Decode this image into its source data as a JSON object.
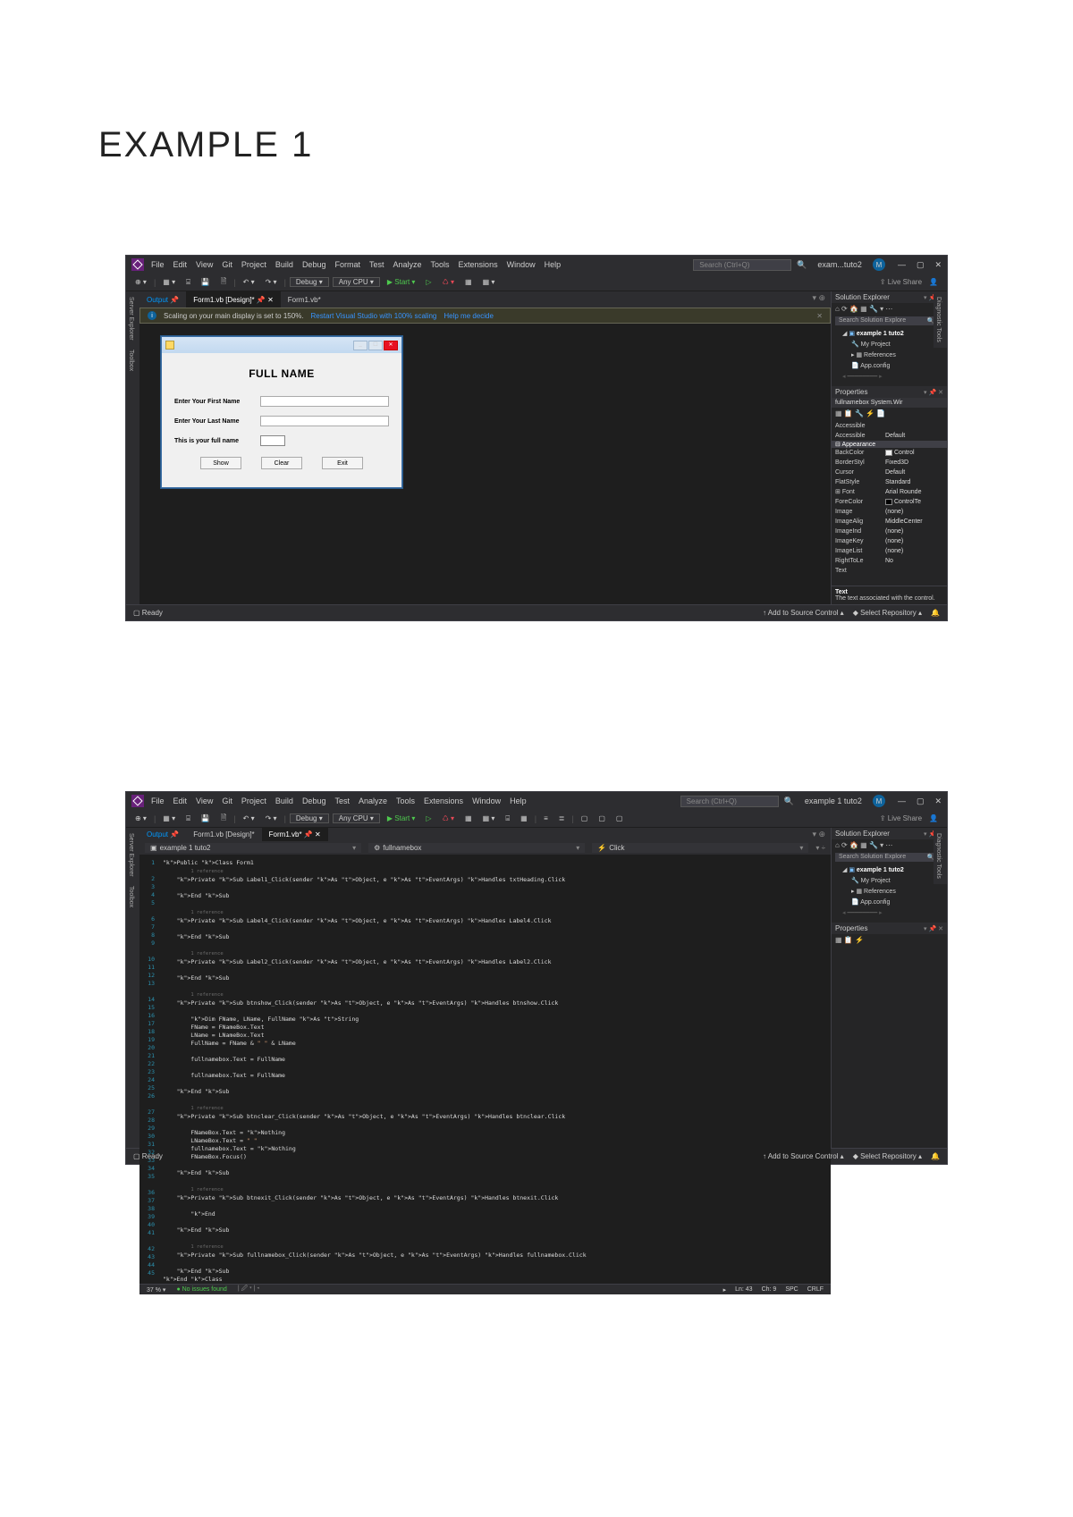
{
  "heading": "EXAMPLE 1",
  "menu": [
    "File",
    "Edit",
    "View",
    "Git",
    "Project",
    "Build",
    "Debug",
    "Format",
    "Test",
    "Analyze",
    "Tools",
    "Extensions",
    "Window",
    "Help"
  ],
  "menu2": [
    "File",
    "Edit",
    "View",
    "Git",
    "Project",
    "Build",
    "Debug",
    "Test",
    "Analyze",
    "Tools",
    "Extensions",
    "Window",
    "Help"
  ],
  "search_placeholder": "Search (Ctrl+Q)",
  "project_title1": "exam...tuto2",
  "project_title2": "example 1 tuto2",
  "liveshare": "Live Share",
  "toolbar": {
    "config": "Debug",
    "platform": "Any CPU",
    "start": "Start"
  },
  "tabs1": {
    "output": "Output",
    "design": "Form1.vb [Design]*",
    "code": "Form1.vb*"
  },
  "tabs2": {
    "output": "Output",
    "design": "Form1.vb [Design]*",
    "code": "Form1.vb*"
  },
  "context": {
    "project": "example 1 tuto2",
    "member": "fullnamebox",
    "event": "Click"
  },
  "notif": {
    "msg": "Scaling on your main display is set to 150%.",
    "link1": "Restart Visual Studio with 100% scaling",
    "link2": "Help me decide"
  },
  "form": {
    "heading": "FULL NAME",
    "row1": "Enter Your First Name",
    "row2": "Enter Your Last Name",
    "row3": "This is your full name",
    "btns": [
      "Show",
      "Clear",
      "Exit"
    ]
  },
  "side_rails": [
    "Server Explorer",
    "Toolbox"
  ],
  "diag_rail": "Diagnostic Tools",
  "solexp": {
    "title": "Solution Explorer",
    "search": "Search Solution Explore",
    "root": "example 1 tuto2",
    "nodes": [
      "My Project",
      "References",
      "App.config"
    ]
  },
  "props": {
    "title": "Properties",
    "object": "fullnamebox System.Wir",
    "rows": [
      {
        "k": "Accessible",
        "v": ""
      },
      {
        "k": "Accessible",
        "v": "Default"
      }
    ],
    "cat": "Appearance",
    "rows2": [
      {
        "k": "BackColor",
        "v": "Control"
      },
      {
        "k": "BorderStyl",
        "v": "Fixed3D"
      },
      {
        "k": "Cursor",
        "v": "Default"
      },
      {
        "k": "FlatStyle",
        "v": "Standard"
      },
      {
        "k": "Font",
        "v": "Arial Rounde"
      },
      {
        "k": "ForeColor",
        "v": "ControlTe"
      },
      {
        "k": "Image",
        "v": "(none)"
      },
      {
        "k": "ImageAlig",
        "v": "MiddleCenter"
      },
      {
        "k": "ImageInd",
        "v": "(none)"
      },
      {
        "k": "ImageKey",
        "v": "(none)"
      },
      {
        "k": "ImageList",
        "v": "(none)"
      },
      {
        "k": "RightToLe",
        "v": "No"
      },
      {
        "k": "Text",
        "v": ""
      }
    ],
    "desc_t": "Text",
    "desc": "The text associated with the control."
  },
  "status": {
    "ready": "Ready",
    "add": "Add to Source Control",
    "repo": "Select Repository"
  },
  "editor_status": {
    "zoom": "37 %",
    "issues": "No issues found",
    "ln": "Ln: 43",
    "ch": "Ch: 9",
    "spc": "SPC",
    "crlf": "CRLF"
  },
  "code_lines": [
    "Public Class Form1",
    "    1 reference",
    "    Private Sub Label1_Click(sender As Object, e As EventArgs) Handles txtHeading.Click",
    "",
    "    End Sub",
    "",
    "    1 reference",
    "    Private Sub Label4_Click(sender As Object, e As EventArgs) Handles Label4.Click",
    "",
    "    End Sub",
    "",
    "    1 reference",
    "    Private Sub Label2_Click(sender As Object, e As EventArgs) Handles Label2.Click",
    "",
    "    End Sub",
    "",
    "    1 reference",
    "    Private Sub btnshow_Click(sender As Object, e As EventArgs) Handles btnshow.Click",
    "",
    "        Dim FName, LName, FullName As String",
    "        FName = FNameBox.Text",
    "        LName = LNameBox.Text",
    "        FullName = FName & \" \" & LName",
    "",
    "        fullnamebox.Text = FullName",
    "",
    "        fullnamebox.Text = FullName",
    "",
    "    End Sub",
    "",
    "    1 reference",
    "    Private Sub btnclear_Click(sender As Object, e As EventArgs) Handles btnclear.Click",
    "",
    "        FNameBox.Text = Nothing",
    "        LNameBox.Text = \" \"",
    "        fullnamebox.Text = Nothing",
    "        FNameBox.Focus()",
    "",
    "    End Sub",
    "",
    "    1 reference",
    "    Private Sub btnexit_Click(sender As Object, e As EventArgs) Handles btnexit.Click",
    "",
    "        End",
    "",
    "    End Sub",
    "",
    "    1 reference",
    "    Private Sub fullnamebox_Click(sender As Object, e As EventArgs) Handles fullnamebox.Click",
    "",
    "    End Sub",
    "End Class"
  ]
}
